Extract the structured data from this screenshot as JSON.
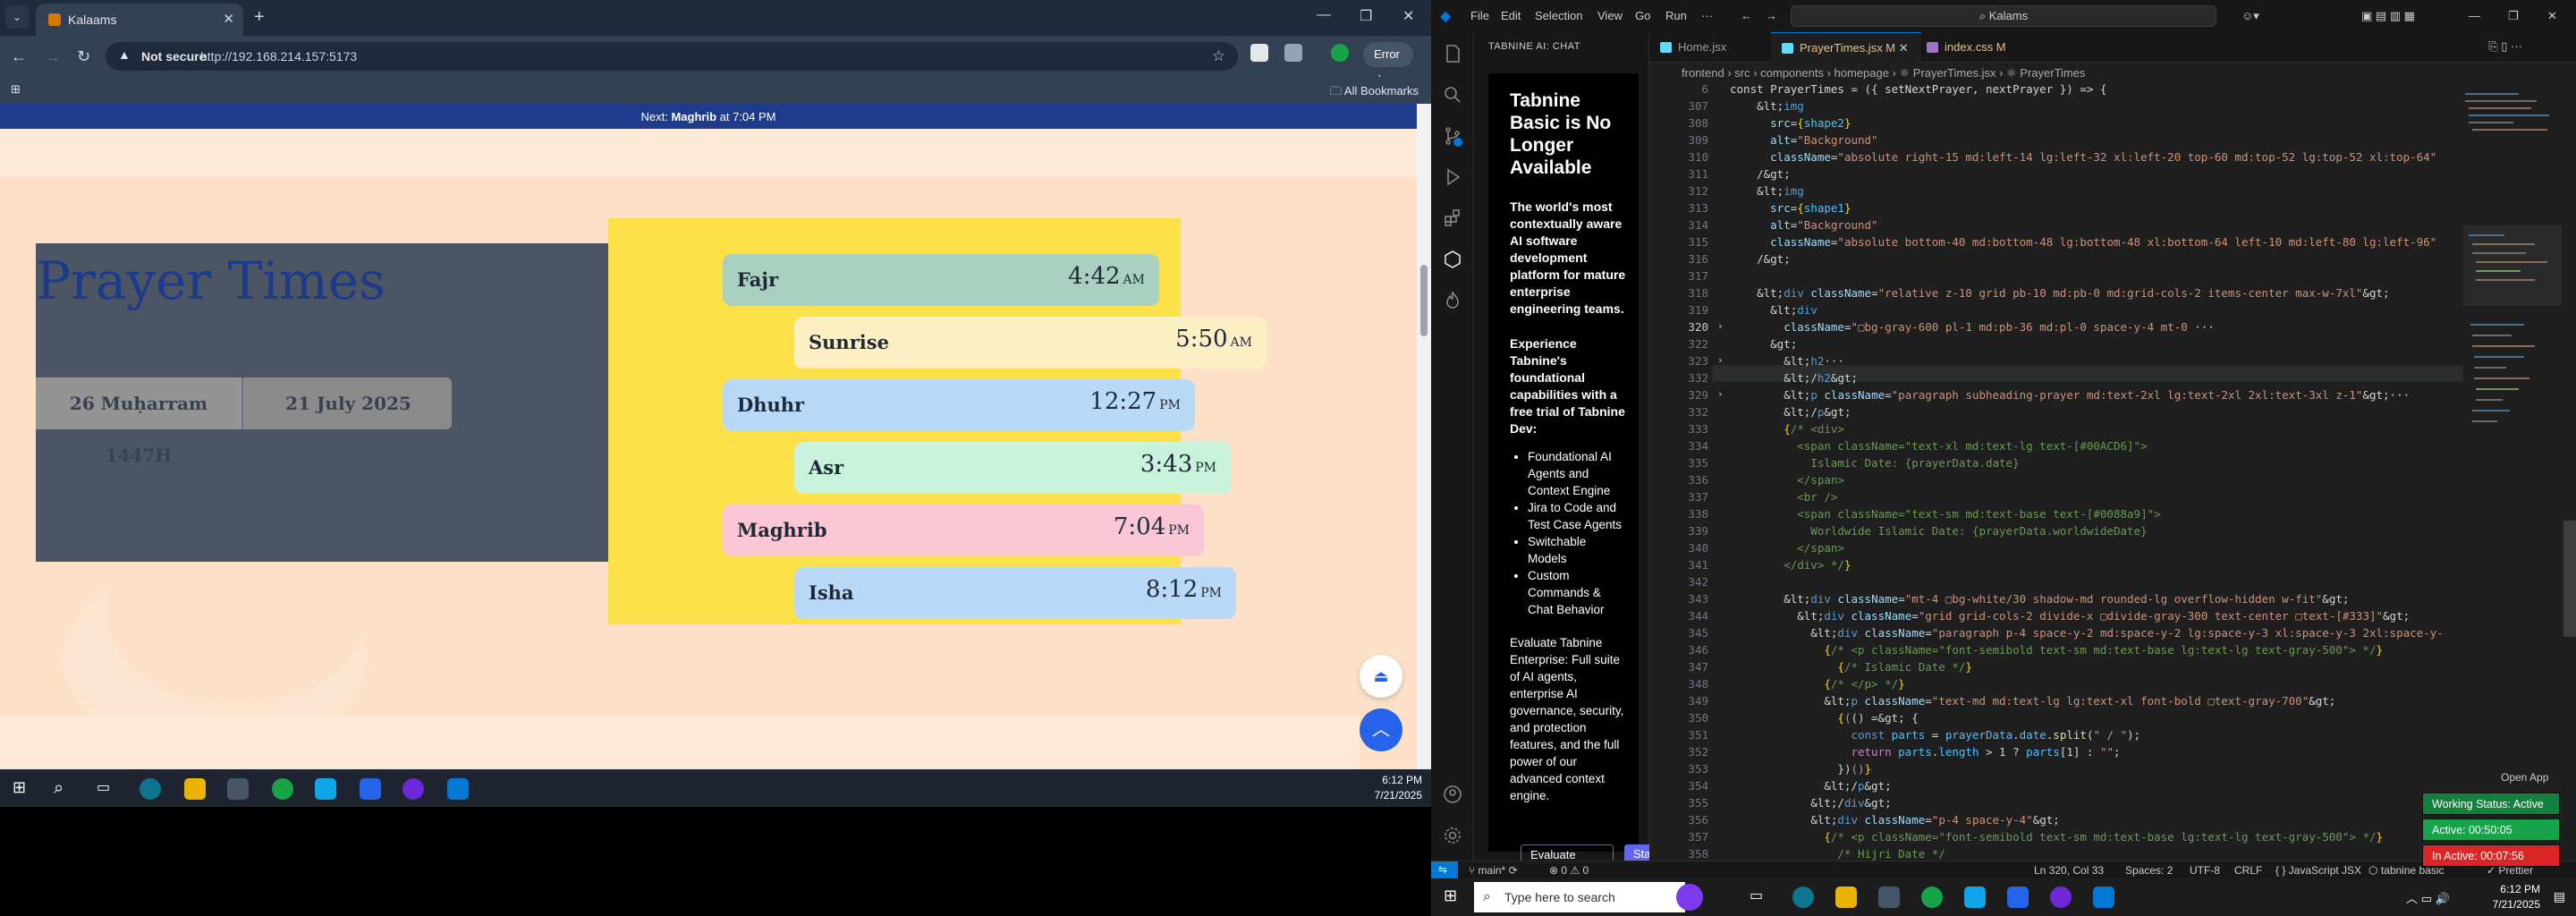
{
  "browser": {
    "tab_title": "Kalaams",
    "tab_close": "✕",
    "new_tab": "+",
    "not_secure": "Not secure",
    "url": "http://192.168.214.157:5173",
    "error_label": "Error",
    "all_bookmarks": "All Bookmarks"
  },
  "app": {
    "next_prefix": "Next: ",
    "next_name": "Maghrib",
    "next_suffix": " at 7:04 PM",
    "title": "Prayer Times",
    "islamic_date": "26 Muḥarram 1447H",
    "gregorian_date": "21 July 2025",
    "prayers": [
      {
        "name": "Fajr",
        "time": "4:42",
        "ampm": "AM",
        "color": "#a9cfc0"
      },
      {
        "name": "Sunrise",
        "time": "5:50",
        "ampm": "AM",
        "color": "#fdefc4"
      },
      {
        "name": "Dhuhr",
        "time": "12:27",
        "ampm": "PM",
        "color": "#b9d9f7"
      },
      {
        "name": "Asr",
        "time": "3:43",
        "ampm": "PM",
        "color": "#c8f2dc"
      },
      {
        "name": "Maghrib",
        "time": "7:04",
        "ampm": "PM",
        "color": "#f8c6d4"
      },
      {
        "name": "Isha",
        "time": "8:12",
        "ampm": "PM",
        "color": "#b9d9f7"
      }
    ]
  },
  "inner_taskbar": {
    "time": "6:12 PM",
    "date": "7/21/2025"
  },
  "vscode": {
    "menu": [
      "File",
      "Edit",
      "Selection",
      "View",
      "Go",
      "Run",
      "···"
    ],
    "search": "Kalams",
    "sidebar_title": "TABNINE AI: CHAT",
    "tabnine": {
      "heading": "Tabnine Basic is No Longer Available",
      "para1": "The world's most contextually aware AI software development platform for mature enterprise engineering teams.",
      "para2": "Experience Tabnine's foundational capabilities with a free trial of Tabnine Dev:",
      "features": [
        "Foundational AI Agents and Context Engine",
        "Jira to Code and Test Case Agents",
        "Switchable Models",
        "Custom Commands & Chat Behavior"
      ],
      "para3": "Evaluate Tabnine Enterprise: Full suite of AI agents, enterprise AI governance, security, and protection features, and the full power of our advanced context engine.",
      "btn_evaluate": "Evaluate enterprise",
      "btn_trial": "Start your Dev trial"
    },
    "tabs": [
      {
        "label": "Home.jsx",
        "active": false
      },
      {
        "label": "PrayerTimes.jsx M",
        "active": true
      },
      {
        "label": "index.css M",
        "active": false
      }
    ],
    "breadcrumb": "frontend › src › components › homepage › ⚛ PrayerTimes.jsx › ⚛ PrayerTimes",
    "sticky": "const PrayerTimes = ({ setNextPrayer, nextPrayer }) => {",
    "sticky_ln": "6",
    "status": {
      "branch": "main*",
      "problems": "⊗ 0 ⚠ 0",
      "position": "Ln 320, Col 33",
      "spaces": "Spaces: 2",
      "encoding": "UTF-8",
      "eol": "CRLF",
      "language": "{ } JavaScript JSX",
      "tabnine": "tabnine basic",
      "prettier": "✓ Prettier"
    }
  },
  "widgets": {
    "open_app": "Open App",
    "working": "Working Status: Active",
    "active": "Active: 00:50:05",
    "inactive": "In Active: 00:07:56"
  },
  "outer_taskbar": {
    "search": "Type here to search",
    "time": "6:12 PM",
    "date": "7/21/2025"
  }
}
